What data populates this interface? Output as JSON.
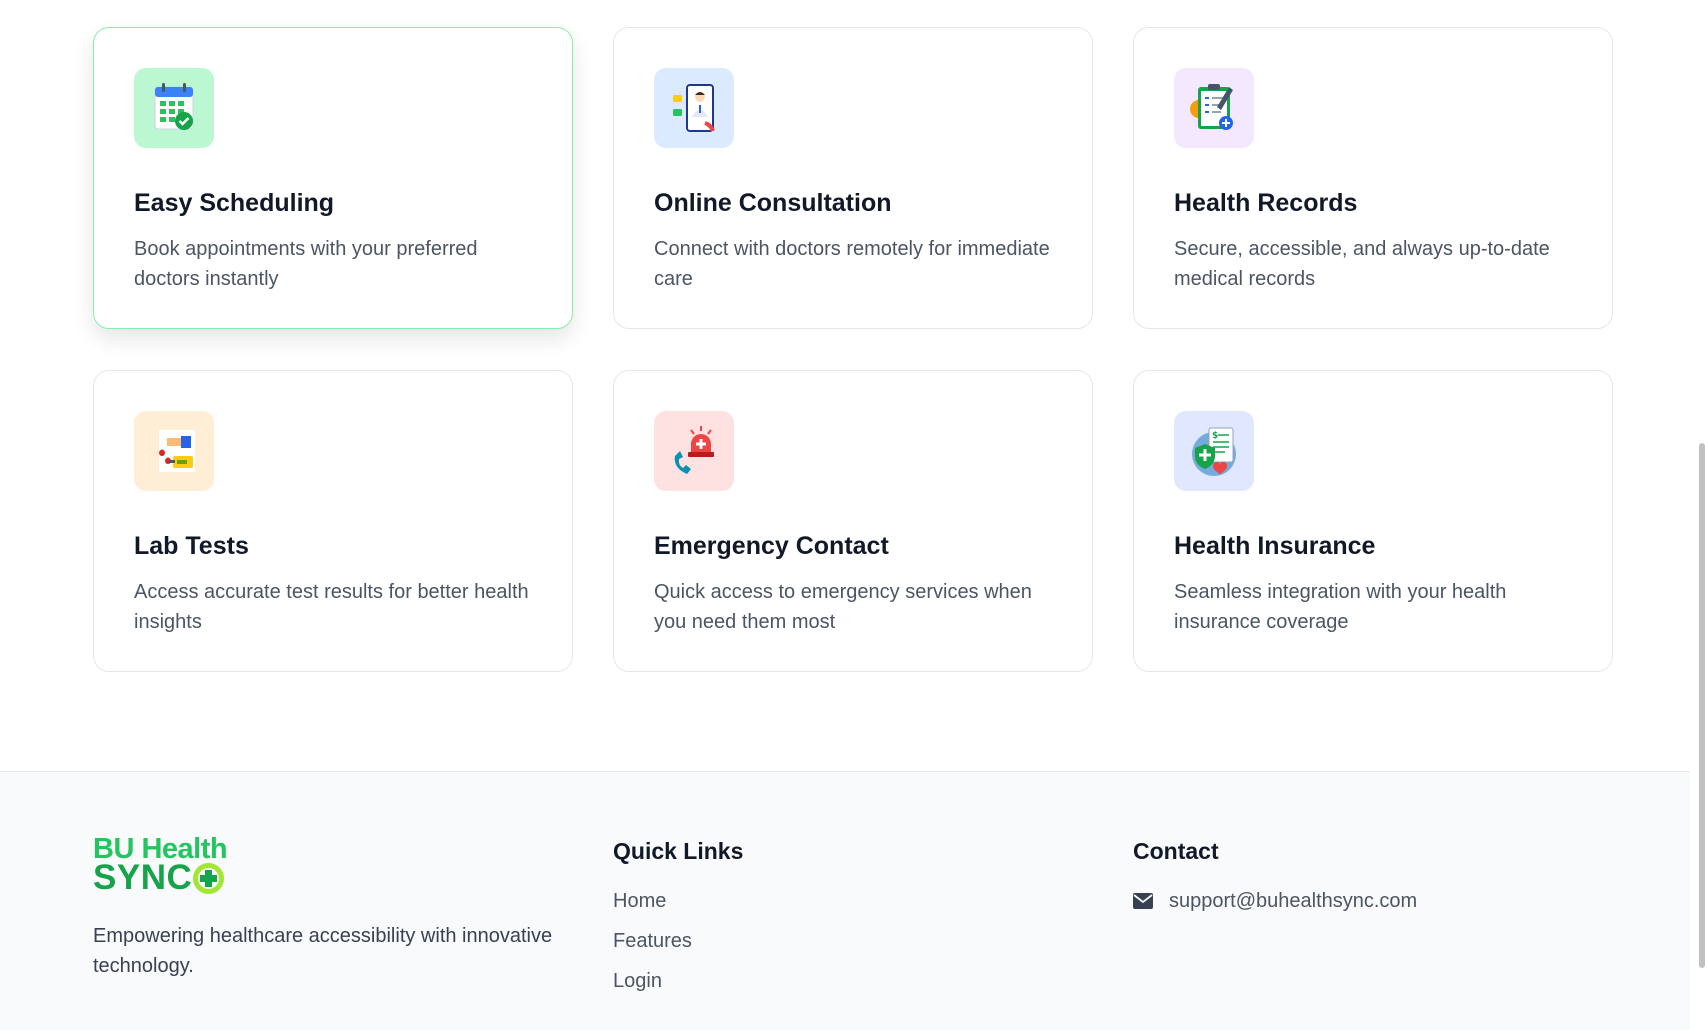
{
  "features": [
    {
      "title": "Easy Scheduling",
      "description": "Book appointments with your preferred doctors instantly",
      "icon": "calendar-check-icon",
      "icon_bg": "#bbf7d0"
    },
    {
      "title": "Online Consultation",
      "description": "Connect with doctors remotely for immediate care",
      "icon": "doctor-video-call-icon",
      "icon_bg": "#dbeafe"
    },
    {
      "title": "Health Records",
      "description": "Secure, accessible, and always up-to-date medical records",
      "icon": "clipboard-records-icon",
      "icon_bg": "#f3e8ff"
    },
    {
      "title": "Lab Tests",
      "description": "Access accurate test results for better health insights",
      "icon": "blood-test-icon",
      "icon_bg": "#ffedd5"
    },
    {
      "title": "Emergency Contact",
      "description": "Quick access to emergency services when you need them most",
      "icon": "emergency-phone-icon",
      "icon_bg": "#fee2e2"
    },
    {
      "title": "Health Insurance",
      "description": "Seamless integration with your health insurance coverage",
      "icon": "insurance-document-icon",
      "icon_bg": "#e0e7ff"
    }
  ],
  "footer": {
    "logo": {
      "line1": "BU Health",
      "line2": "SYNC"
    },
    "tagline": "Empowering healthcare accessibility with innovative technology.",
    "quick_links": {
      "title": "Quick Links",
      "items": [
        "Home",
        "Features",
        "Login"
      ]
    },
    "contact": {
      "title": "Contact",
      "email": "support@buhealthsync.com"
    }
  },
  "colors": {
    "accent_green": "#22c55e",
    "active_card_border": "#86efac"
  }
}
